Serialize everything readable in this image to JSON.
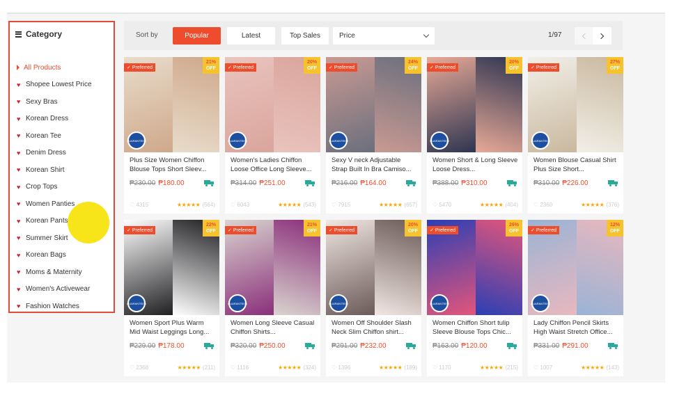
{
  "sidebar": {
    "title": "Category",
    "items": [
      {
        "label": "All Products",
        "active": true
      },
      {
        "label": "Shopee Lowest Price"
      },
      {
        "label": "Sexy Bras"
      },
      {
        "label": "Korean Dress"
      },
      {
        "label": "Korean Tee"
      },
      {
        "label": "Denim Dress"
      },
      {
        "label": "Korean Shirt"
      },
      {
        "label": "Crop Tops"
      },
      {
        "label": "Women Panties"
      },
      {
        "label": "Korean Pants"
      },
      {
        "label": "Summer Skirt"
      },
      {
        "label": "Korean Bags"
      },
      {
        "label": "Moms & Maternity"
      },
      {
        "label": "Women's Activewear"
      },
      {
        "label": "Fashion Watches"
      }
    ]
  },
  "sortbar": {
    "label": "Sort by",
    "buttons": [
      "Popular",
      "Latest",
      "Top Sales"
    ],
    "active": "Popular",
    "price_label": "Price",
    "page_indicator": "1/97"
  },
  "badges": {
    "preferred": "Preferred",
    "off": "OFF",
    "seal": "GUARANTEED"
  },
  "colors": {
    "accent": "#ee4d2d",
    "discount_badge": "#f6c32f",
    "shipping": "#26aa99",
    "stars": "#f6a700"
  },
  "products": [
    {
      "name": "Plus Size Women Chiffon Blouse Tops Short Sleev...",
      "old_price": "₱230.00",
      "price": "₱180.00",
      "discount": "21%",
      "likes": "4315",
      "reviews": "(564)",
      "c1": "#e8dccb",
      "c2": "#cfa88a"
    },
    {
      "name": "Women's Ladies Chiffon Loose Office Long Sleeve...",
      "old_price": "₱314.00",
      "price": "₱251.00",
      "discount": "20%",
      "likes": "6043",
      "reviews": "(543)",
      "c1": "#e9c4bd",
      "c2": "#d9a59c"
    },
    {
      "name": "Sexy V neck Adjustable Strap Built In Bra Camiso...",
      "old_price": "₱216.00",
      "price": "₱164.00",
      "discount": "24%",
      "likes": "7915",
      "reviews": "(657)",
      "c1": "#c99a93",
      "c2": "#6b6f7d"
    },
    {
      "name": "Women Short & Long Sleeve Loose Dress...",
      "old_price": "₱388.00",
      "price": "₱310.00",
      "discount": "20%",
      "likes": "5470",
      "reviews": "(404)",
      "c1": "#e7a996",
      "c2": "#2e3552"
    },
    {
      "name": "Women Blouse Casual Shirt Plus Size Short...",
      "old_price": "₱310.00",
      "price": "₱226.00",
      "discount": "27%",
      "likes": "2360",
      "reviews": "(376)",
      "c1": "#f2efe8",
      "c2": "#c9b89e"
    },
    {
      "name": "Women Sport Plus Warm Mid Waist Leggings Long...",
      "old_price": "₱229.00",
      "price": "₱178.00",
      "discount": "22%",
      "likes": "2368",
      "reviews": "(211)",
      "c1": "#ffffff",
      "c2": "#1f1f22"
    },
    {
      "name": "Women Long Sleeve Casual Chiffon Shirts...",
      "old_price": "₱320.00",
      "price": "₱250.00",
      "discount": "21%",
      "likes": "1116",
      "reviews": "(324)",
      "c1": "#d9d4cf",
      "c2": "#8a2f7a"
    },
    {
      "name": "Women Off Shoulder Slash Neck Slim Chiffon shirt...",
      "old_price": "₱291.00",
      "price": "₱232.00",
      "discount": "20%",
      "likes": "1396",
      "reviews": "(189)",
      "c1": "#f0e6e2",
      "c2": "#6b5a58"
    },
    {
      "name": "Women Chiffon Short tulip Sleeve Blouse Tops Chic...",
      "old_price": "₱163.00",
      "price": "₱120.00",
      "discount": "26%",
      "likes": "1170",
      "reviews": "(215)",
      "c1": "#2b3fb5",
      "c2": "#e4557b"
    },
    {
      "name": "Lady Chiffon Pencil Skirts High Waist Stretch Office...",
      "old_price": "₱331.00",
      "price": "₱291.00",
      "discount": "12%",
      "likes": "1007",
      "reviews": "(143)",
      "c1": "#9ab3d6",
      "c2": "#e8b8be"
    }
  ]
}
